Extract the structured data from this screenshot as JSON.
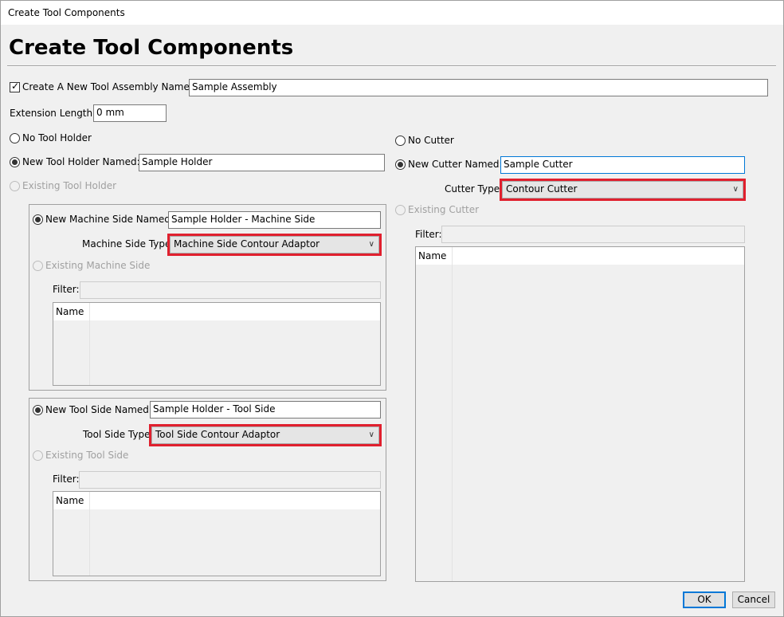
{
  "window": {
    "title": "Create Tool Components"
  },
  "heading": "Create Tool Components",
  "assembly": {
    "label": "Create A New Tool Assembly Named:",
    "checked": true,
    "value": "Sample Assembly"
  },
  "extension": {
    "label": "Extension Length:",
    "value": "0 mm"
  },
  "holder": {
    "no_label": "No Tool Holder",
    "new_label": "New Tool Holder Named:",
    "new_value": "Sample Holder",
    "existing_label": "Existing Tool Holder"
  },
  "machine_side": {
    "new_label": "New Machine Side Named:",
    "new_value": "Sample Holder - Machine Side",
    "type_label": "Machine Side Type:",
    "type_value": "Machine Side Contour Adaptor",
    "existing_label": "Existing Machine Side",
    "filter_label": "Filter:",
    "list_header": "Name"
  },
  "tool_side": {
    "new_label": "New Tool Side Named:",
    "new_value": "Sample Holder - Tool Side",
    "type_label": "Tool Side Type:",
    "type_value": "Tool Side Contour Adaptor",
    "existing_label": "Existing Tool Side",
    "filter_label": "Filter:",
    "list_header": "Name"
  },
  "cutter": {
    "no_label": "No Cutter",
    "new_label": "New Cutter Named:",
    "new_value": "Sample Cutter",
    "type_label": "Cutter Type:",
    "type_value": "Contour Cutter",
    "existing_label": "Existing Cutter",
    "filter_label": "Filter:",
    "list_header": "Name"
  },
  "buttons": {
    "ok": "OK",
    "cancel": "Cancel"
  },
  "icons": {
    "checkbox_mark": "✓",
    "dropdown": "∨"
  },
  "colors": {
    "highlight": "#e0202e",
    "focus": "#0078d7"
  }
}
